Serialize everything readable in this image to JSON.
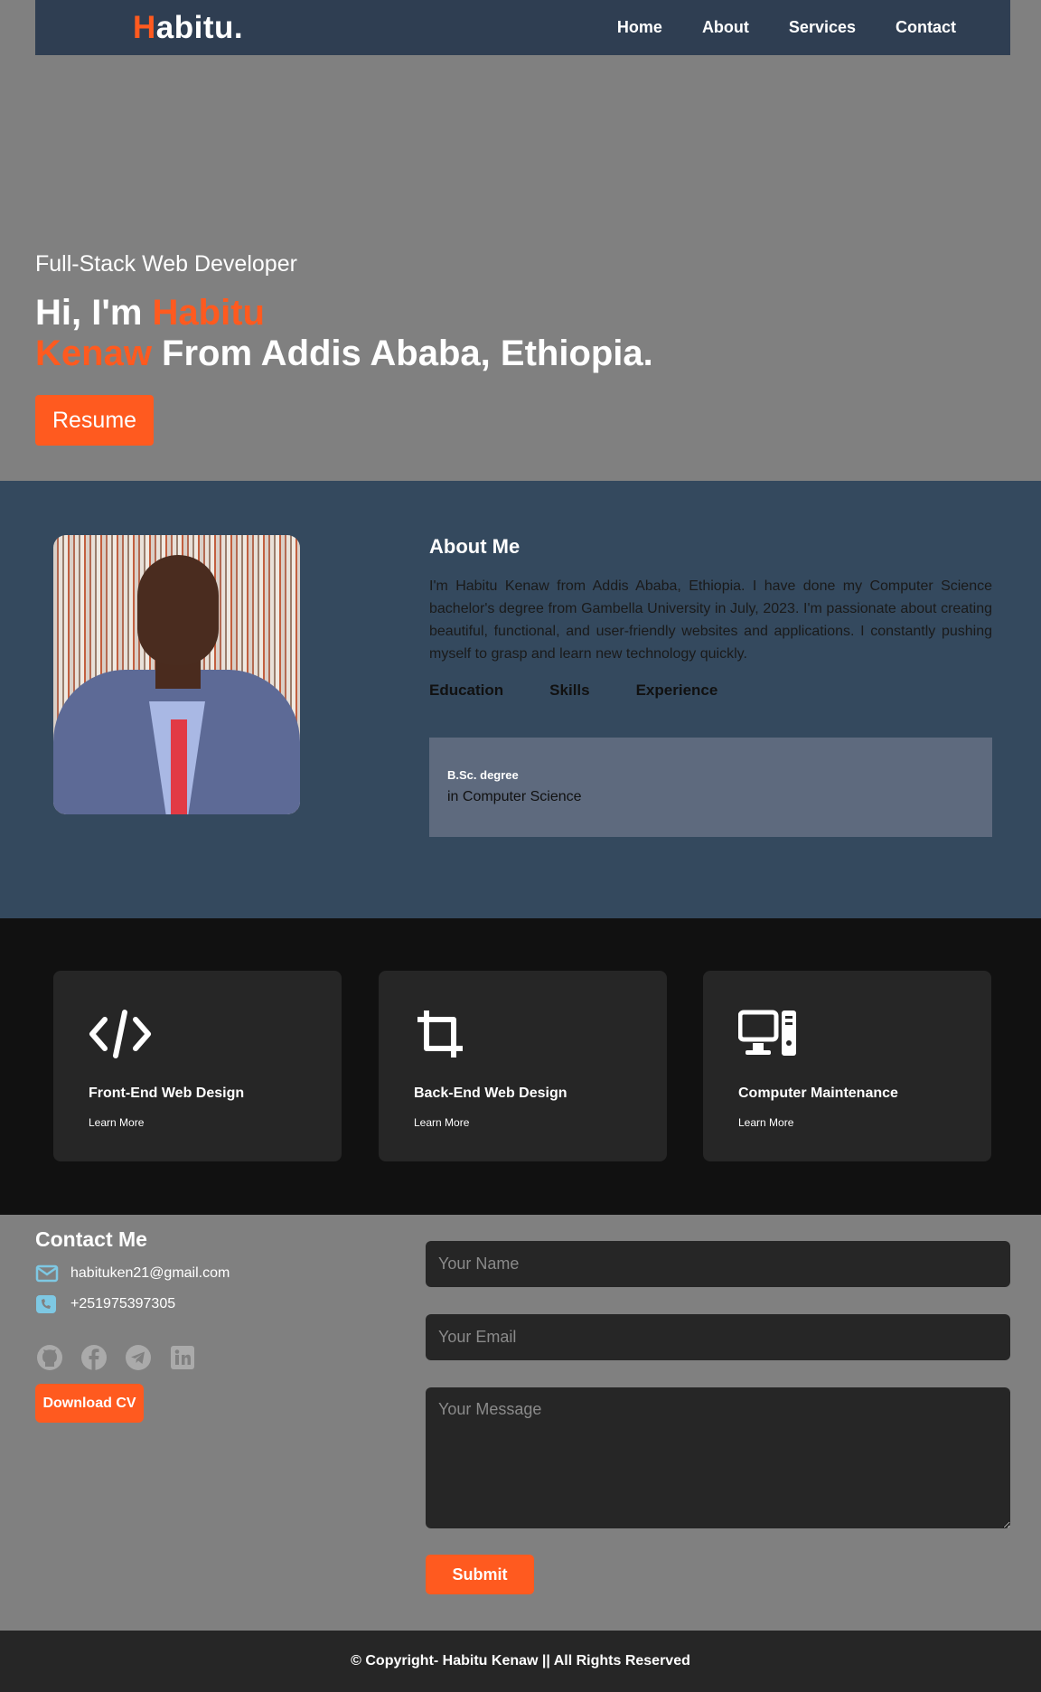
{
  "nav": {
    "logo_first": "H",
    "logo_rest": "abitu.",
    "links": [
      "Home",
      "About",
      "Services",
      "Contact"
    ]
  },
  "hero": {
    "subtitle": "Full-Stack Web Developer",
    "greeting": "Hi, I'm ",
    "name_first": "Habitu",
    "name_last": "Kenaw",
    "from": " From Addis Ababa, Ethiopia.",
    "resume_label": "Resume"
  },
  "about": {
    "title": "About Me",
    "text": "I'm Habitu Kenaw from Addis Ababa, Ethiopia. I have done my Computer Science bachelor's degree from Gambella University in July, 2023. I'm passionate about creating beautiful, functional, and user-friendly websites and applications. I constantly pushing myself to grasp and learn new technology quickly.",
    "tabs": [
      "Education",
      "Skills",
      "Experience"
    ],
    "panel": {
      "degree": "B.Sc. degree",
      "field": "in Computer Science"
    }
  },
  "services": [
    {
      "title": "Front-End Web Design",
      "link": "Learn More",
      "icon": "code-icon"
    },
    {
      "title": "Back-End Web Design",
      "link": "Learn More",
      "icon": "crop-icon"
    },
    {
      "title": "Computer Maintenance",
      "link": "Learn More",
      "icon": "desktop-icon"
    }
  ],
  "contact": {
    "title": "Contact Me",
    "email": "habituken21@gmail.com",
    "phone": "+251975397305",
    "socials": [
      "github-icon",
      "facebook-icon",
      "telegram-icon",
      "linkedin-icon"
    ],
    "download_label": "Download CV",
    "form": {
      "name_placeholder": "Your Name",
      "email_placeholder": "Your Email",
      "message_placeholder": "Your Message",
      "submit_label": "Submit"
    }
  },
  "footer": {
    "text": "© Copyright- Habitu Kenaw || All Rights Reserved"
  },
  "colors": {
    "accent": "#ff5a1f",
    "nav_bg": "#2f3e52",
    "about_bg": "#34495e",
    "services_bg": "#111111",
    "card_bg": "#262626"
  }
}
